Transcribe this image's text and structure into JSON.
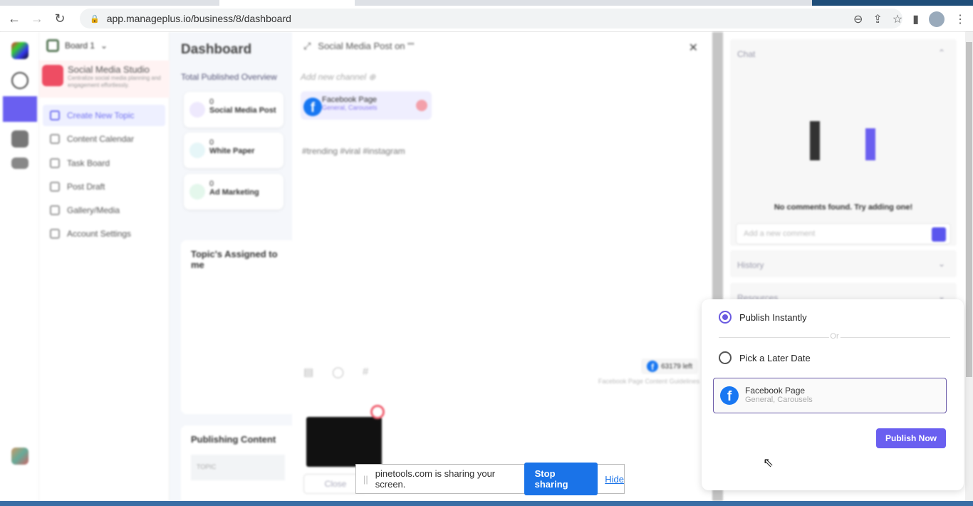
{
  "browser": {
    "url": "app.manageplus.io/business/8/dashboard"
  },
  "sidebar": {
    "board": "Board 1",
    "studio_title": "Social Media Studio",
    "studio_desc": "Centralize social media planning and engagement effortlessly.",
    "items": [
      {
        "label": "Create New Topic",
        "active": true
      },
      {
        "label": "Content Calendar"
      },
      {
        "label": "Task Board"
      },
      {
        "label": "Post Draft"
      },
      {
        "label": "Gallery/Media"
      },
      {
        "label": "Account Settings"
      }
    ]
  },
  "dashboard": {
    "title": "Dashboard",
    "overview": "Total Published Overview",
    "cards": [
      {
        "count": "0",
        "label": "Social Media Post"
      },
      {
        "count": "0",
        "label": "White Paper"
      },
      {
        "count": "0",
        "label": "Ad Marketing"
      }
    ],
    "assigned_title": "Topic's Assigned to me",
    "publishing_title": "Publishing Content",
    "topic_header": "TOPIC"
  },
  "modal": {
    "title": "Social Media Post on \"\"",
    "add_channel": "Add new channel",
    "channel": {
      "name": "Facebook Page",
      "types": "General, Carousels"
    },
    "hashtags": "#trending #viral #instagram",
    "chars_left": "63179 left",
    "guidelines": "Facebook Page Content Guidelines",
    "close": "Close"
  },
  "right_panel": {
    "chat": "Chat",
    "no_comments": "No comments found. Try adding one!",
    "comment_placeholder": "Add a new comment",
    "history": "History",
    "resources": "Resources"
  },
  "publish_popup": {
    "option_instant": "Publish Instantly",
    "or": "Or",
    "option_later": "Pick a Later Date",
    "selected": "instant",
    "channel": {
      "name": "Facebook Page",
      "types": "General, Carousels"
    },
    "publish_button": "Publish Now"
  },
  "screen_share": {
    "message": "pinetools.com is sharing your screen.",
    "stop": "Stop sharing",
    "hide": "Hide"
  },
  "colors": {
    "accent": "#6a5ff0",
    "facebook": "#1877f2",
    "share_blue": "#1a73e8"
  }
}
